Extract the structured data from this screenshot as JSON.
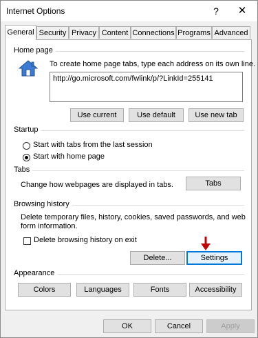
{
  "window": {
    "title": "Internet Options",
    "help": "?",
    "close": "✕"
  },
  "tabs": [
    "General",
    "Security",
    "Privacy",
    "Content",
    "Connections",
    "Programs",
    "Advanced"
  ],
  "home_page": {
    "label": "Home page",
    "instructions": "To create home page tabs, type each address on its own line.",
    "url": "http://go.microsoft.com/fwlink/p/?LinkId=255141",
    "buttons": [
      "Use current",
      "Use default",
      "Use new tab"
    ]
  },
  "startup": {
    "label": "Startup",
    "options": [
      "Start with tabs from the last session",
      "Start with home page"
    ],
    "selected_index": 1
  },
  "tabs_group": {
    "label": "Tabs",
    "description": "Change how webpages are displayed in tabs.",
    "button": "Tabs"
  },
  "browsing_history": {
    "label": "Browsing history",
    "description_line1": "Delete temporary files, history, cookies, saved passwords, and web",
    "description_line2": "form information.",
    "checkbox_label": "Delete browsing history on exit",
    "checkbox_checked": false,
    "delete_button": "Delete...",
    "settings_button": "Settings"
  },
  "appearance": {
    "label": "Appearance",
    "buttons": [
      "Colors",
      "Languages",
      "Fonts",
      "Accessibility"
    ]
  },
  "footer": {
    "ok": "OK",
    "cancel": "Cancel",
    "apply": "Apply"
  },
  "colors": {
    "annotation_arrow": "#c00000",
    "focus": "#0078d7"
  }
}
